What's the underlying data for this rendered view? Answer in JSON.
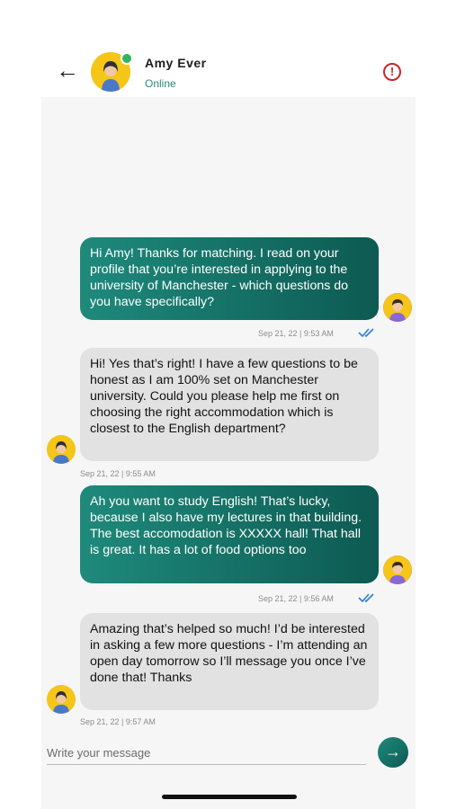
{
  "header": {
    "contact_name": "Amy  Ever",
    "status": "Online",
    "back_icon": "arrow-left-icon",
    "report_icon": "alert-circle-icon",
    "accent_color": "#2fb560"
  },
  "messages": [
    {
      "direction": "outgoing",
      "text": "Hi Amy! Thanks for matching. I read on your profile that you’re interested in applying to the university of Manchester - which questions do you have specifically?",
      "timestamp": "Sep 21, 22  | 9:53 AM"
    },
    {
      "direction": "incoming",
      "text": "Hi! Yes that’s right! I have a few questions to be honest as I am 100% set on Manchester university. Could you please help me first on choosing the right accommodation which is closest to the English department?",
      "timestamp": "Sep 21, 22  | 9:55 AM"
    },
    {
      "direction": "outgoing",
      "text": "Ah you want to study English! That’s lucky, because I also have my lectures in that building. The best accomodation is XXXXX hall! That hall is great. It has a lot of food options too",
      "timestamp": "Sep 21, 22  | 9:56 AM"
    },
    {
      "direction": "incoming",
      "text": "Amazing that’s helped so much! I’d be interested in asking a few more questions - I’m attending an open day tomorrow so I’ll message you once I’ve done that! Thanks",
      "timestamp": "Sep 21, 22  | 9:57 AM"
    }
  ],
  "composer": {
    "placeholder": "Write your message",
    "send_icon": "arrow-right-icon"
  }
}
